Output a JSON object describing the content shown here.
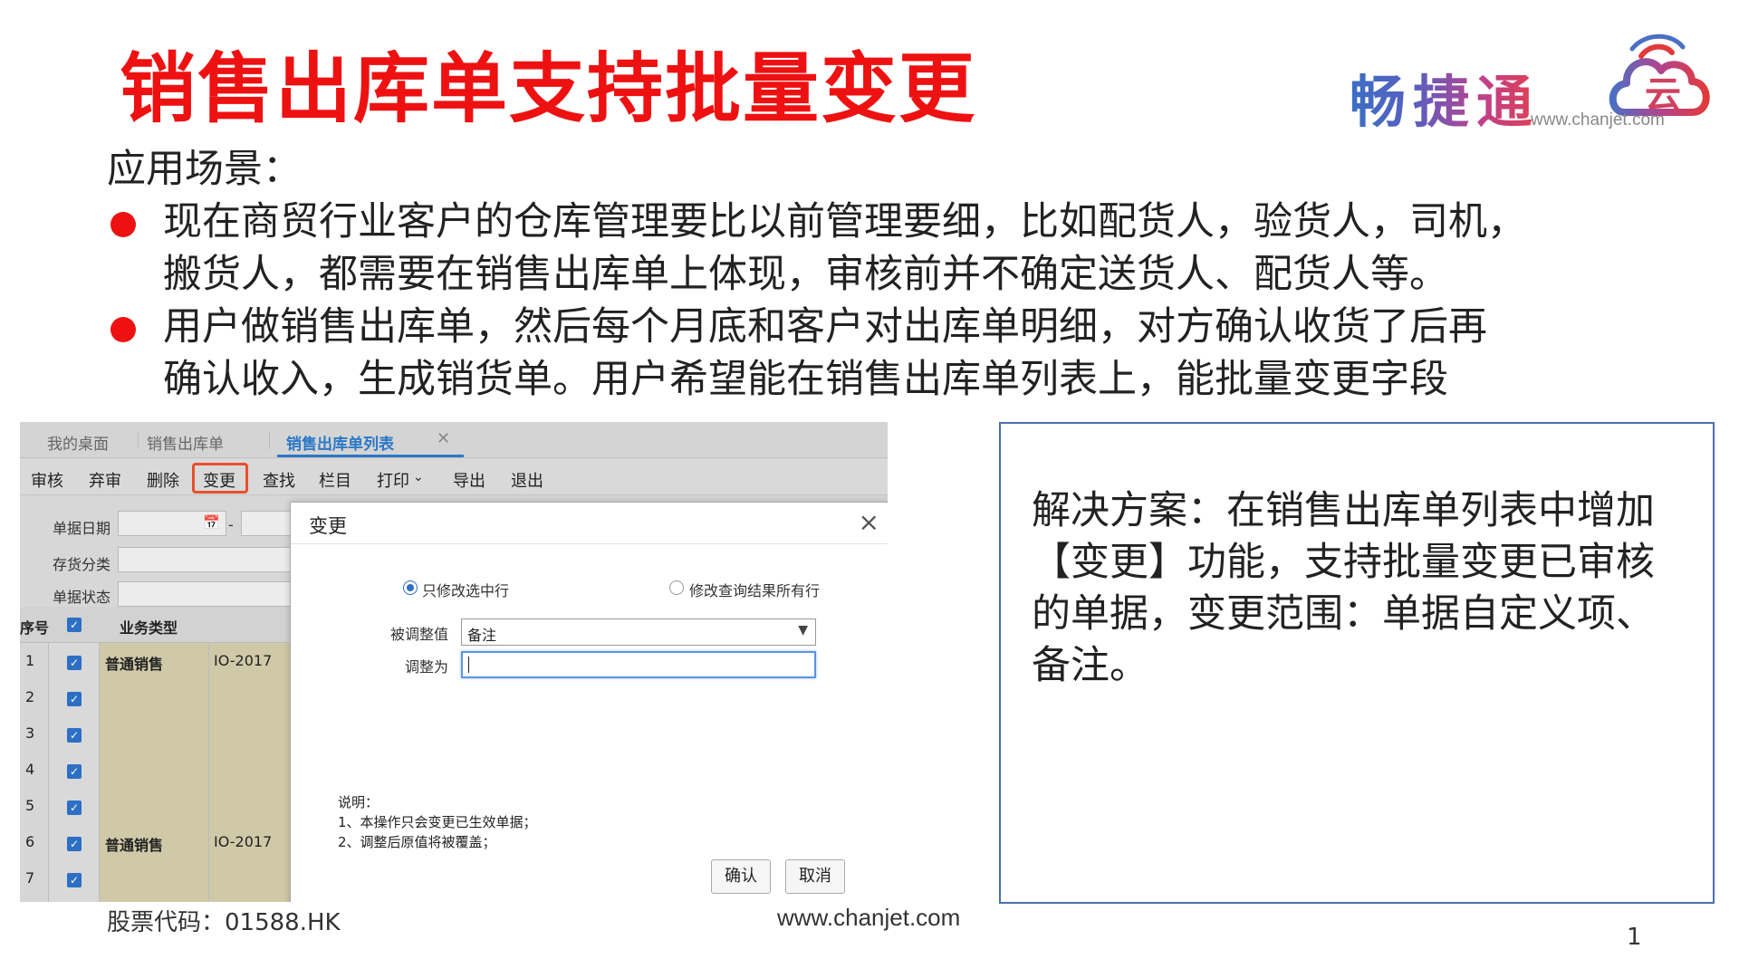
{
  "slide": {
    "title": "销售出库单支持批量变更",
    "scenario_heading": "应用场景：",
    "bullets": [
      {
        "line1": "现在商贸行业客户的仓库管理要比以前管理要细，比如配货人，验货人，司机，",
        "line2": "搬货人，都需要在销售出库单上体现，审核前并不确定送货人、配货人等。"
      },
      {
        "line1": "用户做销售出库单，然后每个月底和客户对出库单明细，对方确认收货了后再",
        "line2": "确认收入，生成销货单。用户希望能在销售出库单列表上，能批量变更字段"
      }
    ],
    "solution": "解决方案：在销售出库单列表中增加【变更】功能，支持批量变更已审核的单据，变更范围：单据自定义项、备注。",
    "footer_stock": "股票代码：01588.HK",
    "footer_url": "www.chanjet.com",
    "page_number": "1"
  },
  "logo": {
    "text": "畅捷通",
    "cloud_char": "云",
    "url": "www.chanjet.com"
  },
  "app": {
    "tabs": [
      "我的桌面",
      "销售出库单",
      "销售出库单列表"
    ],
    "active_tab": "销售出库单列表",
    "toolbar": [
      "审核",
      "弃审",
      "删除",
      "变更",
      "查找",
      "栏目",
      "打印",
      "导出",
      "退出"
    ],
    "print_caret": "⌄",
    "filters": {
      "date_label": "单据日期",
      "date_sep": "-",
      "category_label": "存货分类",
      "status_label": "单据状态"
    },
    "grid": {
      "headers": {
        "seq": "序号",
        "biz_type": "业务类型"
      },
      "rows": [
        {
          "seq": "1",
          "biz": "普通销售",
          "code": "IO-2017"
        },
        {
          "seq": "2",
          "biz": "",
          "code": ""
        },
        {
          "seq": "3",
          "biz": "",
          "code": ""
        },
        {
          "seq": "4",
          "biz": "",
          "code": ""
        },
        {
          "seq": "5",
          "biz": "",
          "code": ""
        },
        {
          "seq": "6",
          "biz": "普通销售",
          "code": "IO-2017"
        },
        {
          "seq": "7",
          "biz": "",
          "code": ""
        }
      ]
    },
    "dialog": {
      "title": "变更",
      "option_selected": "只修改选中行",
      "option_all": "修改查询结果所有行",
      "field_label": "被调整值",
      "field_value": "备注",
      "adjust_label": "调整为",
      "adjust_value": "",
      "notes_title": "说明：",
      "notes": [
        "1、本操作只会变更已生效单据；",
        "2、调整后原值将被覆盖；"
      ],
      "confirm": "确认",
      "cancel": "取消"
    }
  },
  "colors": {
    "title_red": "#ee1111",
    "accent_blue": "#2a78c8",
    "highlight_orange": "#e8502a",
    "solution_border": "#4a6fb0"
  }
}
